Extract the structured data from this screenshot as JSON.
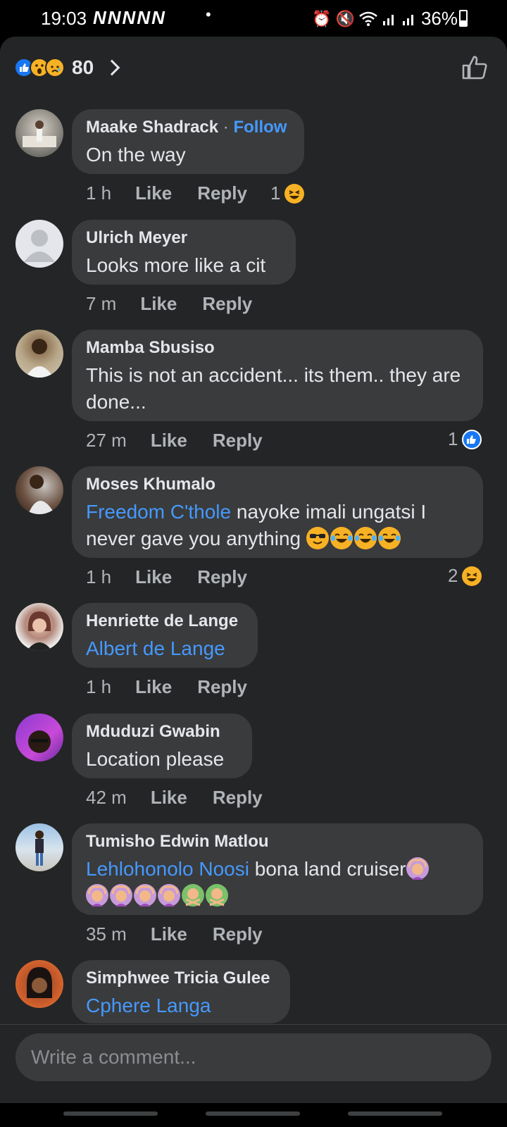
{
  "status_bar": {
    "time": "19:03",
    "notification_icons": "NNNNN",
    "dot": "•",
    "battery": "36%",
    "battery_level": 0.36
  },
  "reactions": {
    "count": "80",
    "icons": [
      "like-reaction-icon",
      "wow-reaction-icon",
      "sad-reaction-icon"
    ]
  },
  "comments": [
    {
      "author": "Maake Shadrack",
      "follow_sep": "·",
      "follow_label": "Follow",
      "text": "On the way",
      "time": "1 h",
      "like_label": "Like",
      "reply_label": "Reply",
      "reaction_count": "1",
      "reaction_icon": "haha-reaction-icon"
    },
    {
      "author": "Ulrich Meyer",
      "text": "Looks more like a cit",
      "time": "7 m",
      "like_label": "Like",
      "reply_label": "Reply"
    },
    {
      "author": "Mamba Sbusiso",
      "text": "This is not an accident... its them.. they are done...",
      "time": "27 m",
      "like_label": "Like",
      "reply_label": "Reply",
      "reaction_count": "1",
      "reaction_icon": "like-reaction-icon"
    },
    {
      "author": "Moses Khumalo",
      "mention": "Freedom C'thole",
      "text": " nayoke imali ungatsi I never gave you anything ",
      "time": "1 h",
      "like_label": "Like",
      "reply_label": "Reply",
      "reaction_count": "2",
      "reaction_icon": "haha-reaction-icon"
    },
    {
      "author": "Henriette de Lange",
      "mention": "Albert de Lange",
      "time": "1 h",
      "like_label": "Like",
      "reply_label": "Reply"
    },
    {
      "author": "Mduduzi Gwabin",
      "text": "Location please",
      "time": "42 m",
      "like_label": "Like",
      "reply_label": "Reply"
    },
    {
      "author": "Tumisho Edwin Matlou",
      "mention": "Lehlohonolo Noosi",
      "text": " bona land cruiser",
      "time": "35 m",
      "like_label": "Like",
      "reply_label": "Reply"
    },
    {
      "author": "Simphwee Tricia Gulee",
      "mention": "Cphere Langa"
    }
  ],
  "composer": {
    "placeholder": "Write a comment..."
  },
  "colors": {
    "background": "#242526",
    "bubble": "#3a3b3c",
    "link": "#4599ff",
    "like_blue": "#1877f2",
    "emoji_yellow": "#f7b125"
  }
}
